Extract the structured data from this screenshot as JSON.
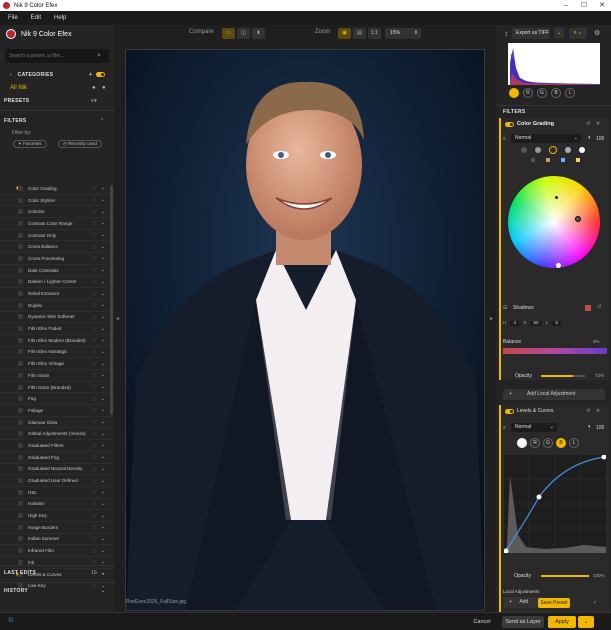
{
  "window": {
    "title": "Nik 9 Color Efex"
  },
  "menu": [
    "File",
    "Edit",
    "Help"
  ],
  "left": {
    "brand": "Nik 9 Color Efex",
    "search_placeholder": "Search a preset, a filter...",
    "categories_label": "CATEGORIES",
    "all_nik": "All Nik",
    "presets_label": "PRESETS",
    "filters_label": "FILTERS",
    "filter_by": "Filter by:",
    "favorites": "Favorites",
    "recently_used": "Recently used",
    "filters": [
      {
        "name": "Color Grading",
        "fav": true
      },
      {
        "name": "Color Stylizer"
      },
      {
        "name": "Colorize"
      },
      {
        "name": "Contrast Color Range"
      },
      {
        "name": "Contrast Only"
      },
      {
        "name": "Cross Balance"
      },
      {
        "name": "Cross Processing"
      },
      {
        "name": "Dark Contrasts"
      },
      {
        "name": "Darken / Lighten Center"
      },
      {
        "name": "Detail Extractor"
      },
      {
        "name": "Duplex"
      },
      {
        "name": "Dynamic Skin Softener"
      },
      {
        "name": "Film Efex Faded"
      },
      {
        "name": "Film Efex Modern (Branded)"
      },
      {
        "name": "Film Efex Nostalgic"
      },
      {
        "name": "Film Efex Vintage"
      },
      {
        "name": "Film Grain"
      },
      {
        "name": "Film Grain (Branded)"
      },
      {
        "name": "Fog"
      },
      {
        "name": "Foliage"
      },
      {
        "name": "Glamour Glow"
      },
      {
        "name": "Global Adjustments (Viveza)"
      },
      {
        "name": "Graduated Filters"
      },
      {
        "name": "Graduated Fog"
      },
      {
        "name": "Graduated Neutral Density"
      },
      {
        "name": "Graduated User Defined"
      },
      {
        "name": "HSL"
      },
      {
        "name": "Halation"
      },
      {
        "name": "High Key"
      },
      {
        "name": "Image Borders"
      },
      {
        "name": "Indian Summer"
      },
      {
        "name": "Infrared Film"
      },
      {
        "name": "Ink"
      },
      {
        "name": "Levels & Curves",
        "fav": true
      },
      {
        "name": "Low Key"
      }
    ],
    "last_edits_label": "LAST EDITS",
    "last_edits_count": "15",
    "history_label": "HISTORY"
  },
  "center": {
    "compare_label": "Compare",
    "zoom_label": "Zoom",
    "zoom_fit": "1:1",
    "zoom_value": "15%",
    "filename": "RonExec2026_FullSize.jpg"
  },
  "right": {
    "export_label": "Export as TIFF",
    "channels": [
      "R",
      "G",
      "B",
      "L"
    ],
    "filters_label": "FILTERS",
    "cg": {
      "title": "Color Grading",
      "mode": "Normal",
      "opacity_top": "100",
      "shadows_label": "Shadows",
      "h_label": "H",
      "h_val": "4",
      "s_label": "S",
      "s_val": "50",
      "l_label": "L",
      "l_val": "5",
      "balance_label": "Balance",
      "balance_val": "0%",
      "opacity_label": "Opacity",
      "opacity_val": "72%",
      "opacity_frac": 0.72,
      "add_local": "Add Local Adjustment"
    },
    "lc": {
      "title": "Levels & Curves",
      "mode": "Normal",
      "opacity_top": "100",
      "channels": [
        "R",
        "G",
        "B",
        "L"
      ],
      "opacity_label": "Opacity",
      "opacity_val": "100%",
      "opacity_frac": 1.0,
      "local_label": "Local Adjustments",
      "add_label": "Add"
    }
  },
  "bottom": {
    "save_preset": "Save Preset",
    "cancel": "Cancel",
    "send_as_layer": "Send as Layer",
    "apply": "Apply"
  },
  "colors": {
    "accent": "#f2b800",
    "logo": "#c0242c",
    "bg": "#242424"
  }
}
